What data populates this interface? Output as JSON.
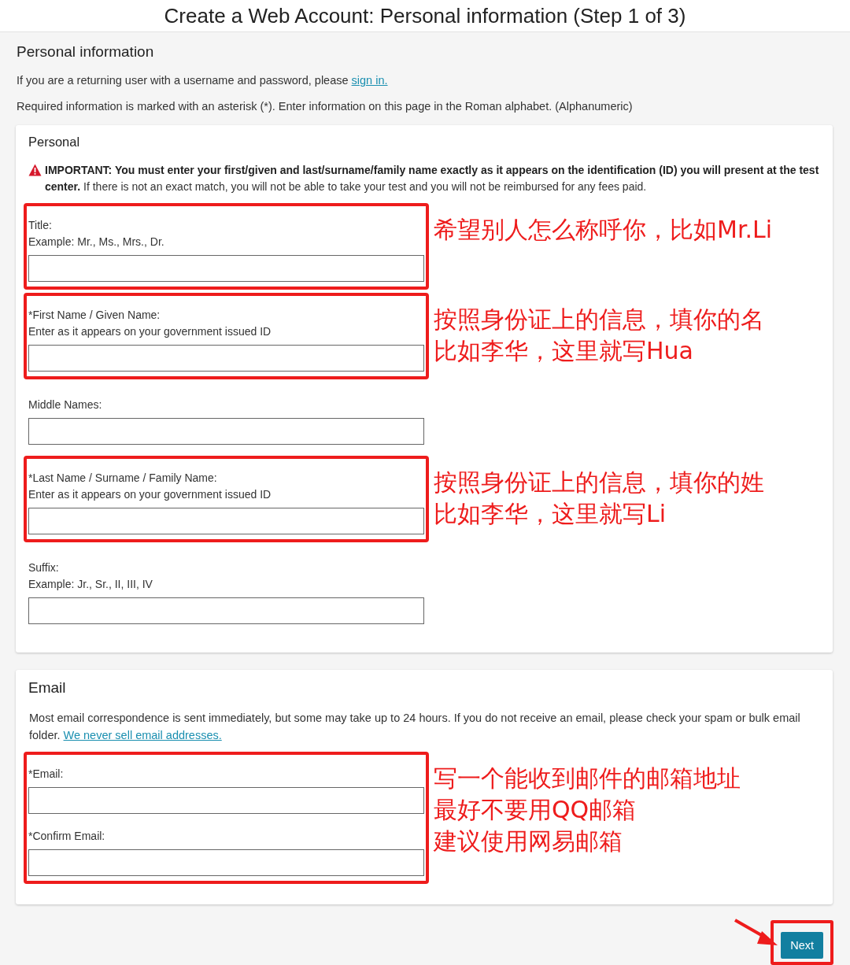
{
  "header": {
    "title": "Create a Web Account: Personal information (Step 1 of 3)"
  },
  "page": {
    "heading": "Personal information",
    "returning": {
      "text": "If you are a returning user with a username and password, please",
      "link": "sign in."
    },
    "required_note": "Required information is marked with an asterisk (*). Enter information on this page in the Roman alphabet. (Alphanumeric)"
  },
  "sections": [
    {
      "title": "Personal",
      "warning": "**IMPORTANT: You must enter your first/given and last/surname/family name exactly as it appears on the identification (ID) you will present at the test center.** If there is not an exact match, you will not be able to take your test and you will not be reimbursed for any fees paid.",
      "groups": [
        {
          "highlighted": true,
          "note": [
            "希望别人怎么称呼你，比如Mr.Li"
          ],
          "fields": [
            {
              "label": "Title:",
              "hint": "Example: Mr., Ms., Mrs., Dr."
            }
          ]
        },
        {
          "highlighted": true,
          "note": [
            "按照身份证上的信息，填你的名",
            "比如李华，这里就写Hua"
          ],
          "fields": [
            {
              "label": "*First Name / Given Name:",
              "hint": "Enter as it appears on your government issued ID"
            }
          ]
        },
        {
          "highlighted": false,
          "fields": [
            {
              "label": "Middle Names:"
            }
          ]
        },
        {
          "highlighted": true,
          "note": [
            "按照身份证上的信息，填你的姓",
            "比如李华，这里就写Li"
          ],
          "fields": [
            {
              "label": "*Last Name / Surname / Family Name:",
              "hint": "Enter as it appears on your government issued ID"
            }
          ]
        },
        {
          "highlighted": false,
          "fields": [
            {
              "label": "Suffix:",
              "hint": "Example: Jr., Sr., II, III, IV"
            }
          ]
        }
      ]
    },
    {
      "title": "Email",
      "intro": {
        "text": "Most email correspondence is sent immediately, but some may take up to 24 hours. If you do not receive an email, please check your spam or bulk email folder.",
        "link": "We never sell email addresses."
      },
      "groups": [
        {
          "highlighted": true,
          "note": [
            "写一个能收到邮件的邮箱地址",
            "最好不要用QQ邮箱",
            "建议使用网易邮箱"
          ],
          "fields": [
            {
              "label": "*Email:"
            },
            {
              "label": "*Confirm Email:"
            }
          ]
        }
      ]
    }
  ],
  "next_button": {
    "label": "Next",
    "highlighted": true
  }
}
